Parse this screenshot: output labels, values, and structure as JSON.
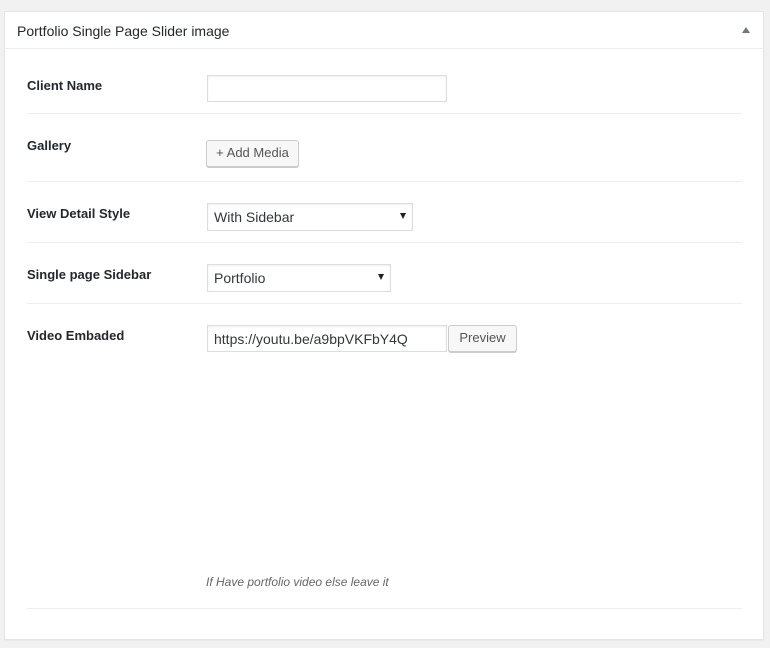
{
  "metabox": {
    "title": "Portfolio Single Page Slider image"
  },
  "fields": {
    "client_name": {
      "label": "Client Name",
      "value": ""
    },
    "gallery": {
      "label": "Gallery",
      "button_label": "+ Add Media"
    },
    "view_detail_style": {
      "label": "View Detail Style",
      "selected": "With Sidebar"
    },
    "single_page_sidebar": {
      "label": "Single page Sidebar",
      "selected": "Portfolio"
    },
    "video_embaded": {
      "label": "Video Embaded",
      "value": "https://youtu.be/a9bpVKFbY4Q",
      "button_label": "Preview",
      "hint": "If Have portfolio video else leave it"
    }
  },
  "colors": {
    "background": "#f1f1f1",
    "panel": "#ffffff",
    "text": "#23282d",
    "border": "#dddddd"
  }
}
